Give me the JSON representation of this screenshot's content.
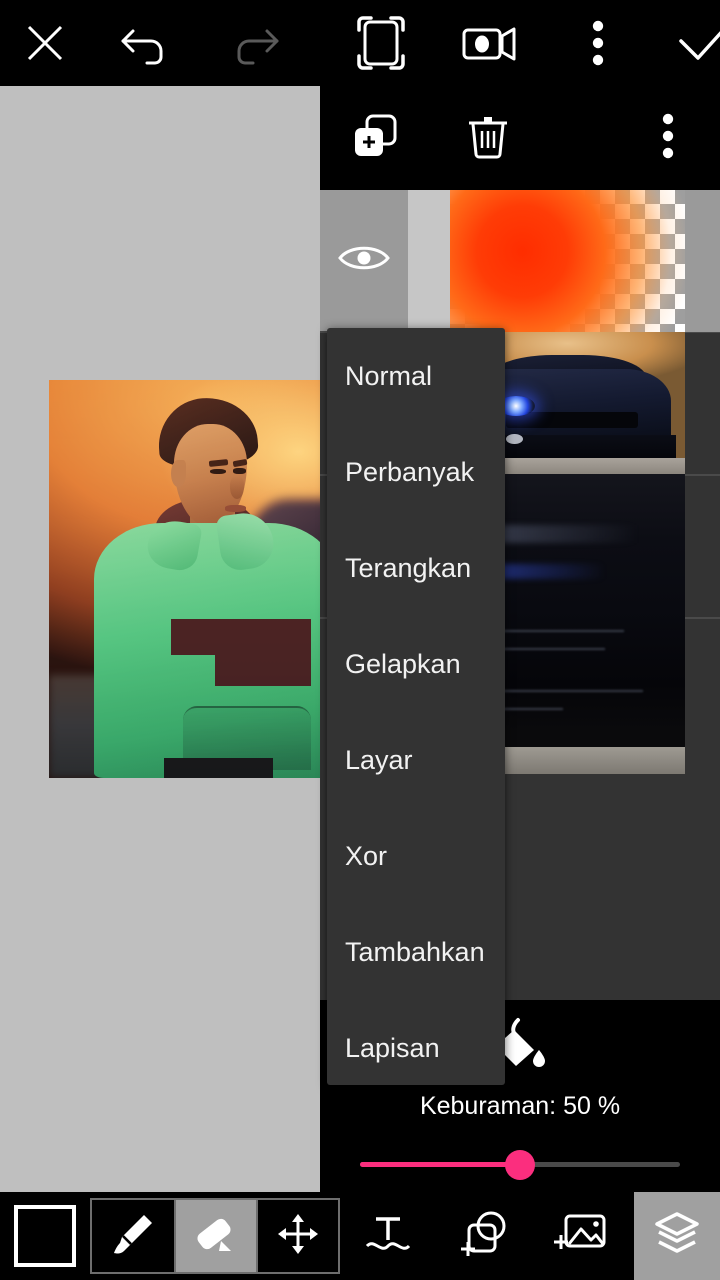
{
  "app": {
    "title": "Photo Editor - Layers"
  },
  "topbar": {
    "buttons": [
      {
        "name": "close-icon",
        "label": "Close"
      },
      {
        "name": "undo-icon",
        "label": "Undo"
      },
      {
        "name": "redo-icon",
        "label": "Redo"
      },
      {
        "name": "crop-frame-icon",
        "label": "Crop"
      },
      {
        "name": "video-camera-icon",
        "label": "Record"
      },
      {
        "name": "more-vertical-icon",
        "label": "More options"
      },
      {
        "name": "check-icon",
        "label": "Apply"
      }
    ]
  },
  "layer_panel": {
    "toolbar": [
      {
        "name": "add-layer-icon",
        "label": "Add layer"
      },
      {
        "name": "delete-layer-icon",
        "label": "Delete layer"
      },
      {
        "name": "layer-more-icon",
        "label": "More"
      }
    ],
    "layers": [
      {
        "name": "layer-row-1",
        "thumb": "orange-radial-gradient-transparent",
        "visible": true,
        "selected": true
      },
      {
        "name": "layer-row-2",
        "thumb": "blue-car-front",
        "visible": true,
        "selected": false
      },
      {
        "name": "layer-row-3",
        "thumb": "dark-car-closeup",
        "visible": true,
        "selected": false
      }
    ],
    "opacity": {
      "label": "Keburaman:  50 %",
      "value": 50,
      "min": 0,
      "max": 100,
      "accent_color": "#fb2e7e",
      "fill_icon": "paint-bucket-icon"
    }
  },
  "blend_menu": {
    "open": true,
    "selected": "Normal",
    "items": [
      {
        "label": "Normal"
      },
      {
        "label": "Perbanyak"
      },
      {
        "label": "Terangkan"
      },
      {
        "label": "Gelapkan"
      },
      {
        "label": "Layar"
      },
      {
        "label": "Xor"
      },
      {
        "label": "Tambahkan"
      },
      {
        "label": "Lapisan"
      }
    ]
  },
  "canvas": {
    "background_color": "#bfbfbf",
    "image_alt": "Man in green hoodie, orange sunset background"
  },
  "bottombar": {
    "color_swatch": {
      "name": "color-swatch",
      "color": "#000000"
    },
    "tools": [
      {
        "name": "brush-tool",
        "label": "Brush",
        "active": false
      },
      {
        "name": "eraser-tool",
        "label": "Eraser",
        "active": true
      },
      {
        "name": "move-tool",
        "label": "Move",
        "active": false
      }
    ],
    "extras": [
      {
        "name": "text-tool",
        "label": "Text"
      },
      {
        "name": "add-shape-tool",
        "label": "Add shape"
      },
      {
        "name": "add-image-tool",
        "label": "Add image"
      }
    ],
    "layers_button": {
      "name": "layers-panel-button",
      "label": "Layers",
      "active": true
    }
  }
}
